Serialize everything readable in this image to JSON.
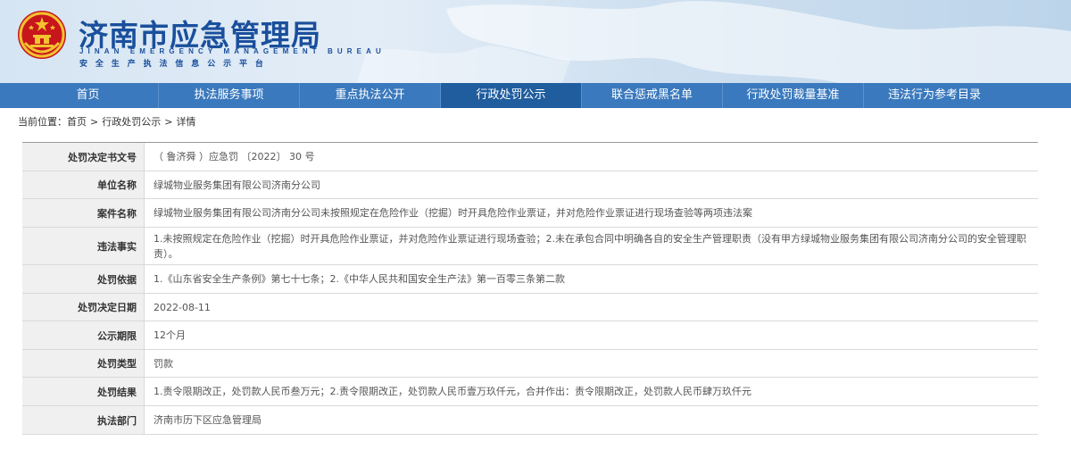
{
  "header": {
    "title": "济南市应急管理局",
    "title_en": "JINAN EMERGENCY MANAGEMENT BUREAU",
    "subtitle": "安全生产执法信息公示平台",
    "emblem_icon": "national-emblem-icon"
  },
  "nav": {
    "items": [
      {
        "label": "首页"
      },
      {
        "label": "执法服务事项"
      },
      {
        "label": "重点执法公开"
      },
      {
        "label": "行政处罚公示"
      },
      {
        "label": "联合惩戒黑名单"
      },
      {
        "label": "行政处罚裁量基准"
      },
      {
        "label": "违法行为参考目录"
      }
    ],
    "active_index": 3
  },
  "breadcrumb": {
    "prefix": "当前位置：",
    "items": [
      "首页",
      "行政处罚公示",
      "详情"
    ],
    "separator": ">"
  },
  "detail": {
    "rows": [
      {
        "label": "处罚决定书文号",
        "value": "（ 鲁济舜 ）应急罚 〔2022〕 30 号"
      },
      {
        "label": "单位名称",
        "value": "绿城物业服务集团有限公司济南分公司"
      },
      {
        "label": "案件名称",
        "value": "绿城物业服务集团有限公司济南分公司未按照规定在危险作业（挖掘）时开具危险作业票证，并对危险作业票证进行现场查验等两项违法案"
      },
      {
        "label": "违法事实",
        "value": "1.未按照规定在危险作业（挖掘）时开具危险作业票证，并对危险作业票证进行现场查验；2.未在承包合同中明确各自的安全生产管理职责（没有甲方绿城物业服务集团有限公司济南分公司的安全管理职责）。"
      },
      {
        "label": "处罚依据",
        "value": "1.《山东省安全生产条例》第七十七条；2.《中华人民共和国安全生产法》第一百零三条第二款"
      },
      {
        "label": "处罚决定日期",
        "value": "2022-08-11"
      },
      {
        "label": "公示期限",
        "value": "12个月"
      },
      {
        "label": "处罚类型",
        "value": "罚款"
      },
      {
        "label": "处罚结果",
        "value": "1.责令限期改正，处罚款人民币叁万元；2.责令限期改正，处罚款人民币壹万玖仟元，合并作出：责令限期改正，处罚款人民币肆万玖仟元"
      },
      {
        "label": "执法部门",
        "value": "济南市历下区应急管理局"
      }
    ]
  },
  "colors": {
    "brand_blue": "#1a4f9c",
    "nav_bg": "#3a79bd",
    "nav_active": "#1f5d9e",
    "label_bg": "#f0f0f0"
  }
}
